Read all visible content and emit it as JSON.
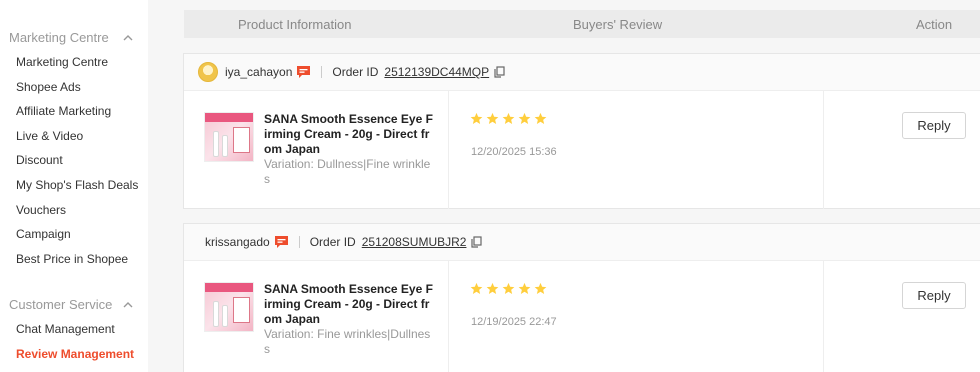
{
  "sidebar": {
    "sections": [
      {
        "title": "Marketing Centre",
        "items": [
          {
            "label": "Marketing Centre"
          },
          {
            "label": "Shopee Ads"
          },
          {
            "label": "Affiliate Marketing"
          },
          {
            "label": "Live & Video"
          },
          {
            "label": "Discount"
          },
          {
            "label": "My Shop's Flash Deals"
          },
          {
            "label": "Vouchers"
          },
          {
            "label": "Campaign"
          },
          {
            "label": "Best Price in Shopee"
          }
        ]
      },
      {
        "title": "Customer Service",
        "items": [
          {
            "label": "Chat Management"
          },
          {
            "label": "Review Management",
            "active": true
          }
        ]
      }
    ]
  },
  "table_header": {
    "product_info": "Product Information",
    "buyers_review": "Buyers' Review",
    "action": "Action"
  },
  "order_id_label": "Order ID",
  "reviews": [
    {
      "username": "iya_cahayon",
      "order_id": "2512139DC44MQP",
      "product_name": "SANA Smooth Essence Eye Firming Cream - 20g - Direct from Japan",
      "variation": "Variation: Dullness|Fine wrinkles",
      "rating": 5,
      "time": "12/20/2025 15:36",
      "action_label": "Reply"
    },
    {
      "username": "krissangado",
      "order_id": "251208SUMUBJR2",
      "product_name": "SANA Smooth Essence Eye Firming Cream - 20g - Direct from Japan",
      "variation": "Variation: Fine wrinkles|Dullness",
      "rating": 5,
      "time": "12/19/2025 22:47",
      "action_label": "Reply"
    }
  ],
  "icons": {
    "chevron": "chevron-up-icon",
    "chat": "chat-icon",
    "copy": "copy-icon",
    "star": "star-icon"
  },
  "colors": {
    "accent": "#ee4d2d",
    "star": "#ffce3d"
  }
}
